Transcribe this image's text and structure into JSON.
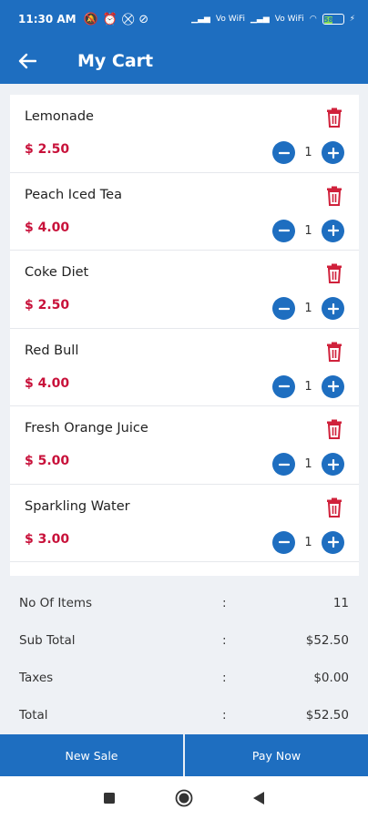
{
  "status_bar": {
    "time": "11:30 AM",
    "icons_left": [
      "mute-icon",
      "alarm-icon",
      "dnd-icon",
      "location-off-icon"
    ],
    "signal_label_1": "Vo WiFi",
    "signal_label_2": "Vo WiFi",
    "battery": "58"
  },
  "app_bar": {
    "title": "My Cart"
  },
  "cart": {
    "items": [
      {
        "name": "Lemonade",
        "price": "$ 2.50",
        "quantity": "1"
      },
      {
        "name": "Peach Iced Tea",
        "price": "$ 4.00",
        "quantity": "1"
      },
      {
        "name": "Coke Diet",
        "price": "$ 2.50",
        "quantity": "1"
      },
      {
        "name": "Red Bull",
        "price": "$ 4.00",
        "quantity": "1"
      },
      {
        "name": "Fresh Orange Juice",
        "price": "$ 5.00",
        "quantity": "1"
      },
      {
        "name": "Sparkling Water",
        "price": "$ 3.00",
        "quantity": "1"
      }
    ]
  },
  "summary": {
    "rows": [
      {
        "label": "No Of Items",
        "separator": ":",
        "value": "11"
      },
      {
        "label": "Sub Total",
        "separator": ":",
        "value": "$52.50"
      },
      {
        "label": "Taxes",
        "separator": ":",
        "value": "$0.00"
      },
      {
        "label": "Total",
        "separator": ":",
        "value": "$52.50"
      }
    ]
  },
  "actions": {
    "new_sale": "New Sale",
    "pay_now": "Pay Now"
  },
  "colors": {
    "primary": "#1e6ec0",
    "price": "#c8113a",
    "delete": "#d0213b"
  }
}
